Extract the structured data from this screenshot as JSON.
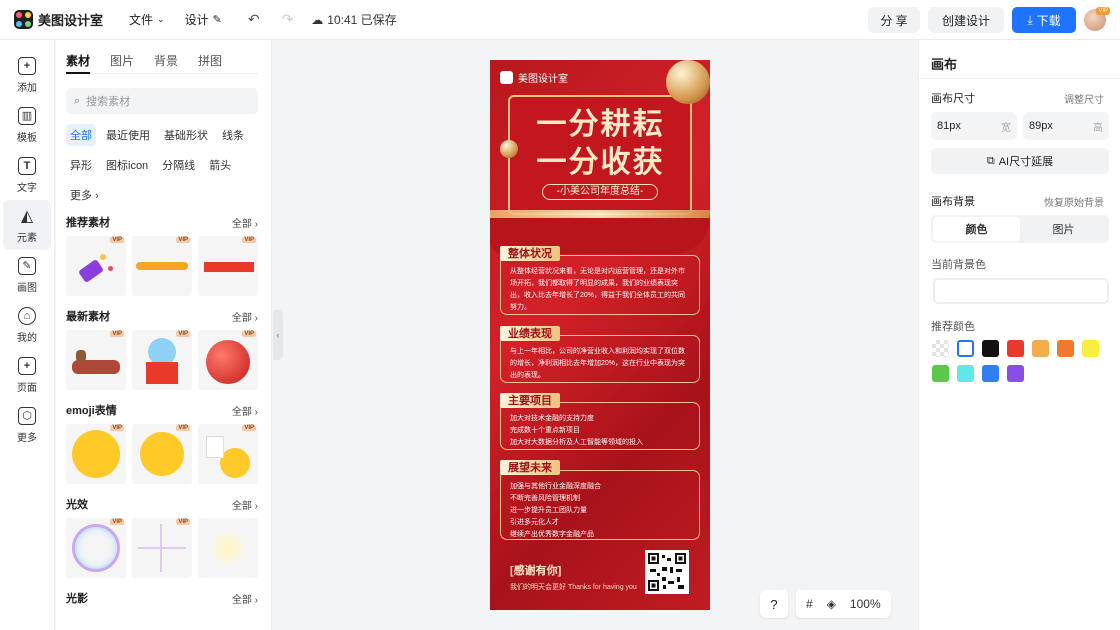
{
  "app": {
    "name": "美图设计室"
  },
  "topbar": {
    "file_menu": "文件",
    "design_menu": "设计",
    "save_status": "10:41 已保存",
    "share": "分 享",
    "create_design": "创建设计",
    "download": "下载",
    "avatar_badge": "VIP"
  },
  "rail": {
    "items": [
      {
        "label": "添加",
        "icon": "plus-icon"
      },
      {
        "label": "模板",
        "icon": "template-icon"
      },
      {
        "label": "文字",
        "icon": "text-icon"
      },
      {
        "label": "元素",
        "icon": "element-icon"
      },
      {
        "label": "画图",
        "icon": "draw-icon"
      },
      {
        "label": "我的",
        "icon": "user-icon"
      },
      {
        "label": "页面",
        "icon": "page-icon"
      },
      {
        "label": "更多",
        "icon": "cube-icon"
      }
    ]
  },
  "panel": {
    "tabs": [
      "素材",
      "图片",
      "背景",
      "拼图"
    ],
    "search_placeholder": "搜索素材",
    "chips": [
      "全部",
      "最近使用",
      "基础形状",
      "线条",
      "异形",
      "图标icon",
      "分隔线",
      "箭头",
      "更多"
    ],
    "all_label": "全部",
    "sections": [
      {
        "title": "推荐素材"
      },
      {
        "title": "最新素材"
      },
      {
        "title": "emoji表情"
      },
      {
        "title": "光效"
      },
      {
        "title": "光影"
      }
    ],
    "vip_badge": "VIP"
  },
  "poster": {
    "brand": "美图设计室",
    "title_line1": "一分耕耘",
    "title_line2": "一分收获",
    "subtitle": "-小美公司年度总结-",
    "sections": [
      {
        "heading": "整体状况",
        "body": "从整体经营状况来看，无论是对内运营管理，还是对外市场开拓，我们都取得了明显的成果，我们的业绩表现突出，收入比去年增长了20%，得益于我们全体员工的共同努力。"
      },
      {
        "heading": "业绩表现",
        "body": "与上一年相比，公司的净营业收入和利润均实现了双位数的增长，净利润相比去年增加20%，这在行业中表现为突出的表现。"
      },
      {
        "heading": "主要项目",
        "body": "加大对技术金融的支持力度\n完成数十个重点新项目\n加大对大数据分析及人工智能等领域的投入"
      },
      {
        "heading": "展望未来",
        "body": "加强与其他行业金融深度融合\n不断完善风险管理机制\n进一步提升员工团队力量\n引进多元化人才\n继续产出优秀数字金融产品"
      }
    ],
    "thanks": "[感谢有你]",
    "footer": "我们的明天会更好  Thanks for having you"
  },
  "zoom": {
    "help": "?",
    "level": "100%"
  },
  "right": {
    "title": "画布",
    "size_label": "画布尺寸",
    "adjust_size": "调整尺寸",
    "width_value": "81px",
    "width_unit": "宽",
    "height_value": "89px",
    "height_unit": "高",
    "ai_extend": "AI尺寸延展",
    "bg_label": "画布背景",
    "restore_bg": "恢复原始背景",
    "seg_color": "颜色",
    "seg_image": "图片",
    "current_bg": "当前背景色",
    "recommended": "推荐颜色",
    "colors": [
      "#e9e9e9",
      "#ffffff",
      "#111111",
      "#e8392b",
      "#f5ac4a",
      "#ef7a2c",
      "#f7ee3f",
      "#5cc84a",
      "#5ee8e8",
      "#2f7ff2",
      "#8a4ee8"
    ]
  }
}
